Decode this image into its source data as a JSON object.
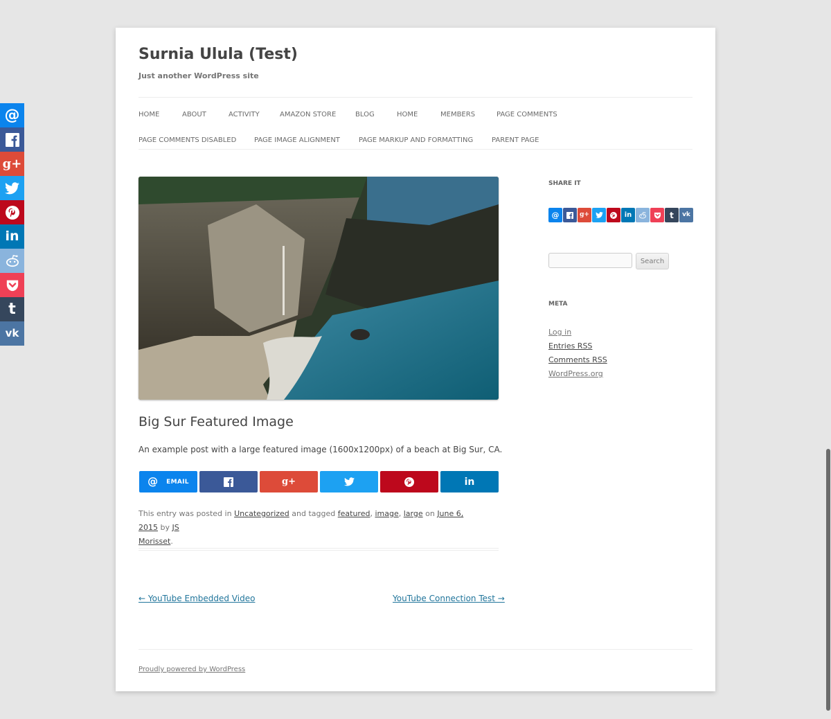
{
  "site": {
    "title": "Surnia Ulula (Test)",
    "description": "Just another WordPress site"
  },
  "nav": {
    "row1": [
      "HOME",
      "ABOUT",
      "ACTIVITY",
      "AMAZON STORE",
      "BLOG",
      "HOME",
      "MEMBERS",
      "PAGE COMMENTS"
    ],
    "row2": [
      "PAGE COMMENTS DISABLED",
      "PAGE IMAGE ALIGNMENT",
      "PAGE MARKUP AND FORMATTING",
      "PARENT PAGE"
    ]
  },
  "post": {
    "title": "Big Sur Featured Image",
    "body": "An example post with a large featured image (1600x1200px) of a beach at Big Sur, CA.",
    "share_email_label": "EMAIL",
    "meta": {
      "prefix": "This entry was posted in",
      "category": "Uncategorized",
      "tagged": "and tagged",
      "tags": [
        "featured",
        "image",
        "large"
      ],
      "on": "on",
      "date": "June 6, 2015",
      "by": "by",
      "author_first": "JS",
      "author_last": "Morisset",
      "end": "."
    }
  },
  "post_nav": {
    "prev": "← YouTube Embedded Video",
    "next": "YouTube Connection Test →"
  },
  "sidebar": {
    "share_title": "SHARE IT",
    "search_button": "Search",
    "meta_title": "META",
    "meta_links": [
      "Log in",
      "Entries RSS",
      "Comments RSS",
      "WordPress.org"
    ]
  },
  "footer": {
    "credit": "Proudly powered by WordPress"
  },
  "colors": {
    "email": "#0b84ed",
    "facebook": "#3b5998",
    "googleplus": "#dd4b39",
    "twitter": "#1da1f2",
    "pinterest": "#bd081c",
    "linkedin": "#0077b5",
    "reddit": "#8ab4dd",
    "pocket": "#ef4056",
    "tumblr": "#35465c",
    "vk": "#4c75a3",
    "link": "#21759b"
  }
}
